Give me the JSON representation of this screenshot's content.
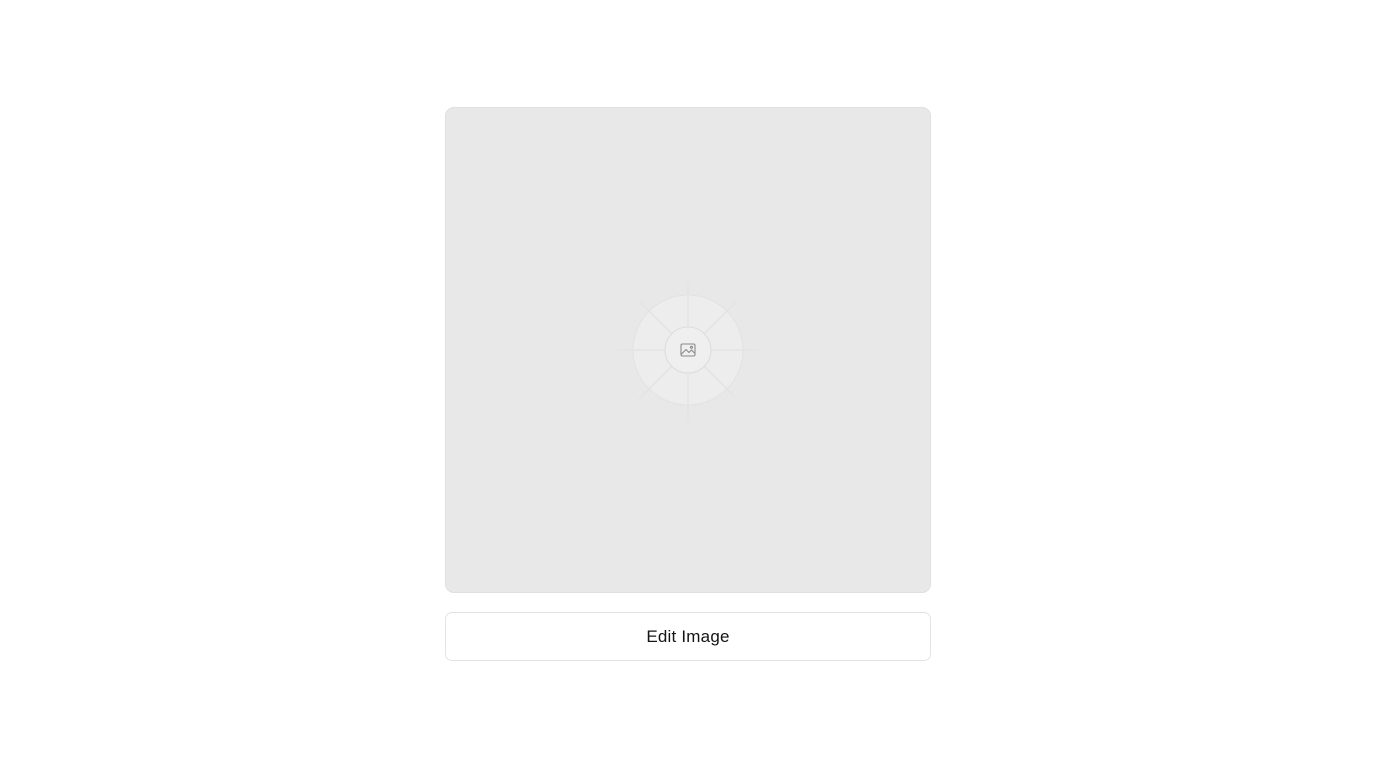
{
  "image": {
    "icon": "image-icon"
  },
  "edit_button": {
    "label": "Edit Image"
  },
  "colors": {
    "background": "#ffffff",
    "placeholder_fill": "#e8e8e8",
    "button_border": "#e3e3e3",
    "button_text": "#141414"
  }
}
